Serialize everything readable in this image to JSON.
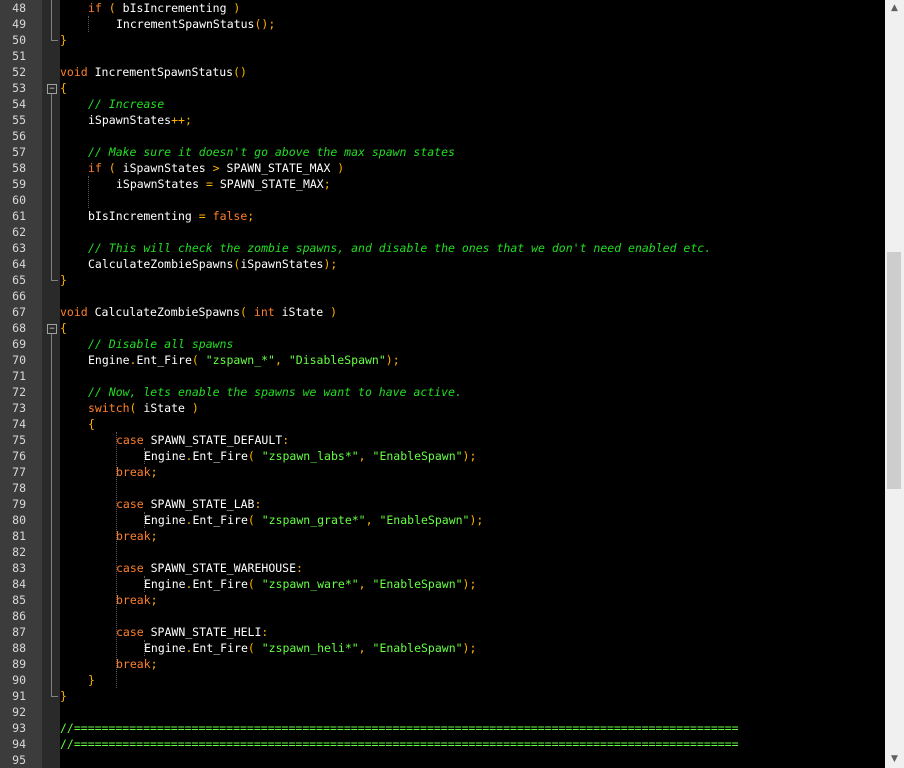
{
  "editor": {
    "lines": [
      {
        "n": "48",
        "i": 1,
        "t": [
          [
            "kw",
            "if"
          ],
          [
            "pn",
            " ( "
          ],
          [
            "fn",
            "bIsIncrementing"
          ],
          [
            "pn",
            " )"
          ]
        ]
      },
      {
        "n": "49",
        "i": 2,
        "t": [
          [
            "fn",
            "IncrementSpawnStatus"
          ],
          [
            "pn",
            "();"
          ]
        ]
      },
      {
        "n": "50",
        "i": 0,
        "t": [
          [
            "pn",
            "}"
          ]
        ]
      },
      {
        "n": "51",
        "i": 0,
        "t": []
      },
      {
        "n": "52",
        "i": 0,
        "t": [
          [
            "kw",
            "void"
          ],
          [
            "fn",
            " IncrementSpawnStatus"
          ],
          [
            "pn",
            "()"
          ]
        ]
      },
      {
        "n": "53",
        "i": 0,
        "t": [
          [
            "pn",
            "{"
          ]
        ]
      },
      {
        "n": "54",
        "i": 1,
        "t": [
          [
            "cm",
            "// Increase"
          ]
        ]
      },
      {
        "n": "55",
        "i": 1,
        "t": [
          [
            "fn",
            "iSpawnStates"
          ],
          [
            "pn",
            "++;"
          ]
        ]
      },
      {
        "n": "56",
        "i": 0,
        "t": []
      },
      {
        "n": "57",
        "i": 1,
        "t": [
          [
            "cm",
            "// Make sure it doesn't go above the max spawn states"
          ]
        ]
      },
      {
        "n": "58",
        "i": 1,
        "t": [
          [
            "kw",
            "if"
          ],
          [
            "pn",
            " ( "
          ],
          [
            "fn",
            "iSpawnStates "
          ],
          [
            "pn",
            ">"
          ],
          [
            "fn",
            " SPAWN_STATE_MAX "
          ],
          [
            "pn",
            ")"
          ]
        ]
      },
      {
        "n": "59",
        "i": 2,
        "t": [
          [
            "fn",
            "iSpawnStates "
          ],
          [
            "pn",
            "="
          ],
          [
            "fn",
            " SPAWN_STATE_MAX"
          ],
          [
            "pn",
            ";"
          ]
        ]
      },
      {
        "n": "60",
        "i": 0,
        "t": []
      },
      {
        "n": "61",
        "i": 1,
        "t": [
          [
            "fn",
            "bIsIncrementing "
          ],
          [
            "pn",
            "="
          ],
          [
            "kw",
            " false"
          ],
          [
            "pn",
            ";"
          ]
        ]
      },
      {
        "n": "62",
        "i": 0,
        "t": []
      },
      {
        "n": "63",
        "i": 1,
        "t": [
          [
            "cm",
            "// This will check the zombie spawns, and disable the ones that we don't need enabled etc."
          ]
        ]
      },
      {
        "n": "64",
        "i": 1,
        "t": [
          [
            "fn",
            "CalculateZombieSpawns"
          ],
          [
            "pn",
            "("
          ],
          [
            "fn",
            "iSpawnStates"
          ],
          [
            "pn",
            ");"
          ]
        ]
      },
      {
        "n": "65",
        "i": 0,
        "t": [
          [
            "pn",
            "}"
          ]
        ]
      },
      {
        "n": "66",
        "i": 0,
        "t": []
      },
      {
        "n": "67",
        "i": 0,
        "t": [
          [
            "kw",
            "void"
          ],
          [
            "fn",
            " CalculateZombieSpawns"
          ],
          [
            "pn",
            "( "
          ],
          [
            "kw",
            "int"
          ],
          [
            "fn",
            " iState "
          ],
          [
            "pn",
            ")"
          ]
        ]
      },
      {
        "n": "68",
        "i": 0,
        "t": [
          [
            "pn",
            "{"
          ]
        ]
      },
      {
        "n": "69",
        "i": 1,
        "t": [
          [
            "cm",
            "// Disable all spawns"
          ]
        ]
      },
      {
        "n": "70",
        "i": 1,
        "t": [
          [
            "fn",
            "Engine"
          ],
          [
            "pn",
            "."
          ],
          [
            "fn",
            "Ent_Fire"
          ],
          [
            "pn",
            "( "
          ],
          [
            "str",
            "\"zspawn_*\""
          ],
          [
            "pn",
            ", "
          ],
          [
            "str",
            "\"DisableSpawn\""
          ],
          [
            "pn",
            ");"
          ]
        ]
      },
      {
        "n": "71",
        "i": 0,
        "t": []
      },
      {
        "n": "72",
        "i": 1,
        "t": [
          [
            "cm",
            "// Now, lets enable the spawns we want to have active."
          ]
        ]
      },
      {
        "n": "73",
        "i": 1,
        "t": [
          [
            "kw",
            "switch"
          ],
          [
            "pn",
            "( "
          ],
          [
            "fn",
            "iState "
          ],
          [
            "pn",
            ")"
          ]
        ]
      },
      {
        "n": "74",
        "i": 1,
        "t": [
          [
            "pn",
            "{"
          ]
        ]
      },
      {
        "n": "75",
        "i": 2,
        "t": [
          [
            "kw",
            "case"
          ],
          [
            "fn",
            " SPAWN_STATE_DEFAULT"
          ],
          [
            "pn",
            ":"
          ]
        ]
      },
      {
        "n": "76",
        "i": 3,
        "t": [
          [
            "fn",
            "Engine"
          ],
          [
            "pn",
            "."
          ],
          [
            "fn",
            "Ent_Fire"
          ],
          [
            "pn",
            "( "
          ],
          [
            "str",
            "\"zspawn_labs*\""
          ],
          [
            "pn",
            ", "
          ],
          [
            "str",
            "\"EnableSpawn\""
          ],
          [
            "pn",
            ");"
          ]
        ]
      },
      {
        "n": "77",
        "i": 2,
        "t": [
          [
            "kw",
            "break"
          ],
          [
            "pn",
            ";"
          ]
        ]
      },
      {
        "n": "78",
        "i": 0,
        "t": []
      },
      {
        "n": "79",
        "i": 2,
        "t": [
          [
            "kw",
            "case"
          ],
          [
            "fn",
            " SPAWN_STATE_LAB"
          ],
          [
            "pn",
            ":"
          ]
        ]
      },
      {
        "n": "80",
        "i": 3,
        "t": [
          [
            "fn",
            "Engine"
          ],
          [
            "pn",
            "."
          ],
          [
            "fn",
            "Ent_Fire"
          ],
          [
            "pn",
            "( "
          ],
          [
            "str",
            "\"zspawn_grate*\""
          ],
          [
            "pn",
            ", "
          ],
          [
            "str",
            "\"EnableSpawn\""
          ],
          [
            "pn",
            ");"
          ]
        ]
      },
      {
        "n": "81",
        "i": 2,
        "t": [
          [
            "kw",
            "break"
          ],
          [
            "pn",
            ";"
          ]
        ]
      },
      {
        "n": "82",
        "i": 0,
        "t": []
      },
      {
        "n": "83",
        "i": 2,
        "t": [
          [
            "kw",
            "case"
          ],
          [
            "fn",
            " SPAWN_STATE_WAREHOUSE"
          ],
          [
            "pn",
            ":"
          ]
        ]
      },
      {
        "n": "84",
        "i": 3,
        "t": [
          [
            "fn",
            "Engine"
          ],
          [
            "pn",
            "."
          ],
          [
            "fn",
            "Ent_Fire"
          ],
          [
            "pn",
            "( "
          ],
          [
            "str",
            "\"zspawn_ware*\""
          ],
          [
            "pn",
            ", "
          ],
          [
            "str",
            "\"EnableSpawn\""
          ],
          [
            "pn",
            ");"
          ]
        ]
      },
      {
        "n": "85",
        "i": 2,
        "t": [
          [
            "kw",
            "break"
          ],
          [
            "pn",
            ";"
          ]
        ]
      },
      {
        "n": "86",
        "i": 0,
        "t": []
      },
      {
        "n": "87",
        "i": 2,
        "t": [
          [
            "kw",
            "case"
          ],
          [
            "fn",
            " SPAWN_STATE_HELI"
          ],
          [
            "pn",
            ":"
          ]
        ]
      },
      {
        "n": "88",
        "i": 3,
        "t": [
          [
            "fn",
            "Engine"
          ],
          [
            "pn",
            "."
          ],
          [
            "fn",
            "Ent_Fire"
          ],
          [
            "pn",
            "( "
          ],
          [
            "str",
            "\"zspawn_heli*\""
          ],
          [
            "pn",
            ", "
          ],
          [
            "str",
            "\"EnableSpawn\""
          ],
          [
            "pn",
            ");"
          ]
        ]
      },
      {
        "n": "89",
        "i": 2,
        "t": [
          [
            "kw",
            "break"
          ],
          [
            "pn",
            ";"
          ]
        ]
      },
      {
        "n": "90",
        "i": 1,
        "t": [
          [
            "pn",
            "}"
          ]
        ]
      },
      {
        "n": "91",
        "i": 0,
        "t": [
          [
            "pn",
            "}"
          ]
        ]
      },
      {
        "n": "92",
        "i": 0,
        "t": []
      },
      {
        "n": "93",
        "i": 0,
        "t": [
          [
            "str",
            "//================================================================================================"
          ]
        ]
      },
      {
        "n": "94",
        "i": 0,
        "t": [
          [
            "str",
            "//================================================================================================"
          ]
        ]
      },
      {
        "n": "95",
        "i": 0,
        "t": []
      }
    ]
  },
  "scrollbar": {
    "up_icon": "▲",
    "down_icon": "▼"
  }
}
